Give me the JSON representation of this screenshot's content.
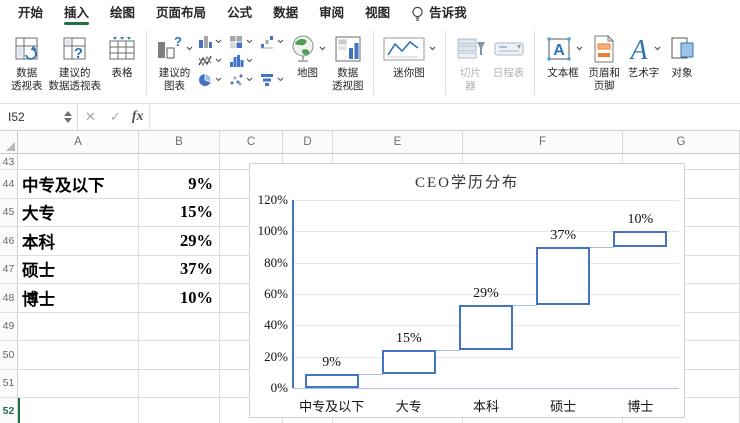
{
  "tabs": {
    "items": [
      {
        "label": "开始",
        "active": false
      },
      {
        "label": "插入",
        "active": true
      },
      {
        "label": "绘图",
        "active": false
      },
      {
        "label": "页面布局",
        "active": false
      },
      {
        "label": "公式",
        "active": false
      },
      {
        "label": "数据",
        "active": false
      },
      {
        "label": "审阅",
        "active": false
      },
      {
        "label": "视图",
        "active": false
      }
    ],
    "tell_me": "告诉我"
  },
  "ribbon": {
    "pivot_table": "数据\n透视表",
    "recommended_pivot": "建议的\n数据透视表",
    "table": "表格",
    "recommended_chart": "建议的\n图表",
    "map": "地图",
    "pivot_chart": "数据\n透视图",
    "sparkline": "迷你图",
    "slicer": "切片\n器",
    "timeline": "日程表",
    "text_box": "文本框",
    "header_footer": "页眉和\n页脚",
    "wordart": "艺术字",
    "object": "对象"
  },
  "formula_bar": {
    "name_box": "I52",
    "cancel": "✕",
    "enter": "✓",
    "fx": "fx"
  },
  "sheet": {
    "column_headers": [
      "A",
      "B",
      "C",
      "D",
      "E",
      "F",
      "G"
    ],
    "rows": [
      {
        "n": "43",
        "A": "",
        "B": ""
      },
      {
        "n": "44",
        "A": "中专及以下",
        "B": "9%"
      },
      {
        "n": "45",
        "A": "大专",
        "B": "15%"
      },
      {
        "n": "46",
        "A": "本科",
        "B": "29%"
      },
      {
        "n": "47",
        "A": "硕士",
        "B": "37%"
      },
      {
        "n": "48",
        "A": "博士",
        "B": "10%"
      },
      {
        "n": "49",
        "A": "",
        "B": ""
      },
      {
        "n": "50",
        "A": "",
        "B": ""
      },
      {
        "n": "51",
        "A": "",
        "B": ""
      },
      {
        "n": "52",
        "A": "",
        "B": "",
        "active": true
      }
    ],
    "active_cell": "I52"
  },
  "chart_data": {
    "type": "bar",
    "subtype": "waterfall-floating-bars",
    "title": "CEO学历分布",
    "categories": [
      "中专及以下",
      "大专",
      "本科",
      "硕士",
      "博士"
    ],
    "values": [
      9,
      15,
      29,
      37,
      10
    ],
    "starts": [
      0,
      9,
      24,
      53,
      90
    ],
    "data_labels": [
      "9%",
      "15%",
      "29%",
      "37%",
      "10%"
    ],
    "y_ticks": [
      "0%",
      "20%",
      "40%",
      "60%",
      "80%",
      "100%",
      "120%"
    ],
    "ylim": [
      0,
      120
    ],
    "grid": true,
    "legend": "none",
    "colors": {
      "bar_border": "#4472C4",
      "bar_fill": "#FFFFFF",
      "connector": "#9DC3E6",
      "y_axis": "#4472C4",
      "x_axis": "#A9C6E8",
      "gridline": "#E2E8F2"
    }
  },
  "colors": {
    "accent_green": "#217346",
    "excel_blue": "#4472C4"
  }
}
